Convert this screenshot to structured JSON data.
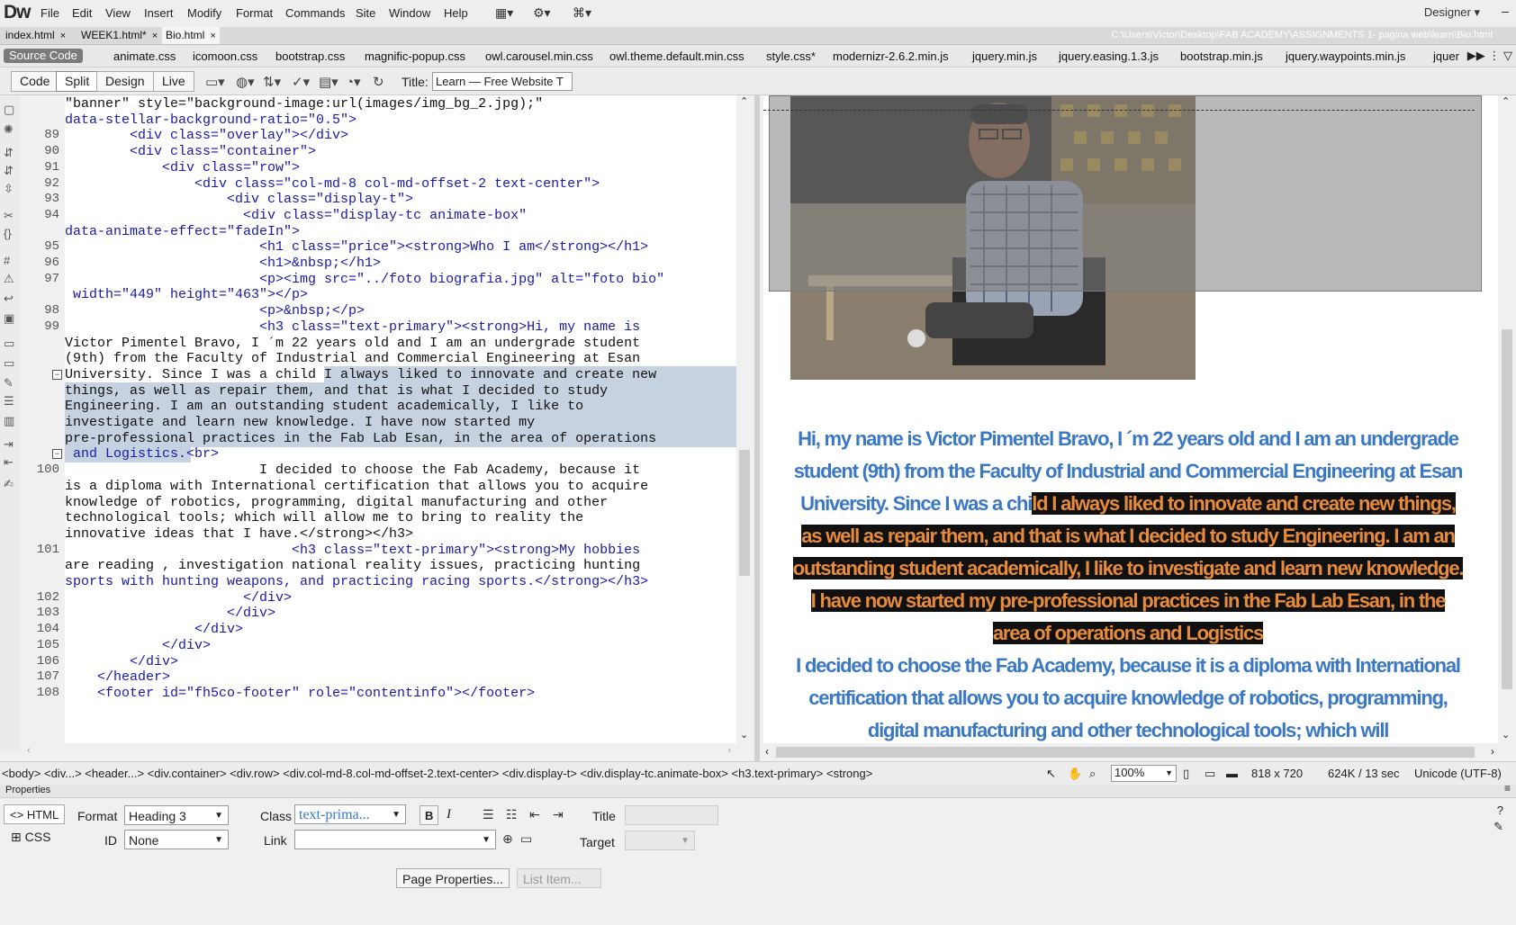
{
  "app": {
    "logo": "Dw",
    "layout_mode": "Designer"
  },
  "menu": [
    "File",
    "Edit",
    "View",
    "Insert",
    "Modify",
    "Format",
    "Commands",
    "Site",
    "Window",
    "Help"
  ],
  "doc_tabs": [
    {
      "label": "index.html",
      "active": false
    },
    {
      "label": "WEEK1.html*",
      "active": false
    },
    {
      "label": "Bio.html",
      "active": true
    }
  ],
  "doc_path": "C:\\Users\\Victor\\Desktop\\FAB ACADEMY\\ASSIGNMENTS 1- pagina web\\learn\\Bio.html",
  "related": {
    "source_code": "Source Code",
    "files": [
      "animate.css",
      "icomoon.css",
      "bootstrap.css",
      "magnific-popup.css",
      "owl.carousel.min.css",
      "owl.theme.default.min.css",
      "style.css*",
      "modernizr-2.6.2.min.js",
      "jquery.min.js",
      "jquery.easing.1.3.js",
      "bootstrap.min.js",
      "jquery.waypoints.min.js",
      "jquer"
    ]
  },
  "view_buttons": [
    "Code",
    "Split",
    "Design",
    "Live"
  ],
  "title_label": "Title:",
  "title_value": "Learn — Free Website T",
  "code_lines": [
    {
      "n": "",
      "t": "\"banner\" style=\"background-image:url(images/img_bg_2.jpg);\""
    },
    {
      "n": "",
      "t": "data-stellar-background-ratio=\"0.5\">"
    },
    {
      "n": "89",
      "t": "        <div class=\"overlay\"></div>"
    },
    {
      "n": "90",
      "t": "        <div class=\"container\">"
    },
    {
      "n": "91",
      "t": "            <div class=\"row\">"
    },
    {
      "n": "92",
      "t": "                <div class=\"col-md-8 col-md-offset-2 text-center\">"
    },
    {
      "n": "93",
      "t": "                    <div class=\"display-t\">"
    },
    {
      "n": "94",
      "t": "                      <div class=\"display-tc animate-box\""
    },
    {
      "n": "",
      "t": "data-animate-effect=\"fadeIn\">"
    },
    {
      "n": "95",
      "t": "                        <h1 class=\"price\"><strong>Who I am</strong></h1>"
    },
    {
      "n": "96",
      "t": "                        <h1>&nbsp;</h1>"
    },
    {
      "n": "97",
      "t": "                        <p><img src=\"../foto biografia.jpg\" alt=\"foto bio\""
    },
    {
      "n": "",
      "t": " width=\"449\" height=\"463\"></p>"
    },
    {
      "n": "98",
      "t": "                        <p>&nbsp;</p>"
    },
    {
      "n": "99",
      "t": "                        <h3 class=\"text-primary\"><strong>Hi, my name is"
    },
    {
      "n": "",
      "t": "Victor Pimentel Bravo, I ´m 22 years old and I am an undergrade student"
    },
    {
      "n": "",
      "t": "(9th) from the Faculty of Industrial and Commercial Engineering at Esan"
    },
    {
      "n": "",
      "t": "University. Since I was a child I always liked to innovate and create new"
    },
    {
      "n": "",
      "t": "things, as well as repair them, and that is what I decided to study"
    },
    {
      "n": "",
      "t": "Engineering. I am an outstanding student academically, I like to"
    },
    {
      "n": "",
      "t": "investigate and learn new knowledge. I have now started my"
    },
    {
      "n": "",
      "t": "pre-professional practices in the Fab Lab Esan, in the area of operations"
    },
    {
      "n": "",
      "t": " and Logistics.<br>"
    },
    {
      "n": "100",
      "t": "                        I decided to choose the Fab Academy, because it"
    },
    {
      "n": "",
      "t": "is a diploma with International certification that allows you to acquire"
    },
    {
      "n": "",
      "t": "knowledge of robotics, programming, digital manufacturing and other"
    },
    {
      "n": "",
      "t": "technological tools; which will allow me to bring to reality the"
    },
    {
      "n": "",
      "t": "innovative ideas that I have.</strong></h3>"
    },
    {
      "n": "101",
      "t": "                            <h3 class=\"text-primary\"><strong>My hobbies"
    },
    {
      "n": "",
      "t": "are reading , investigation national reality issues, practicing hunting"
    },
    {
      "n": "",
      "t": "sports with hunting weapons, and practicing racing sports.</strong></h3>"
    },
    {
      "n": "102",
      "t": "                      </div>"
    },
    {
      "n": "103",
      "t": "                    </div>"
    },
    {
      "n": "104",
      "t": "                </div>"
    },
    {
      "n": "105",
      "t": "            </div>"
    },
    {
      "n": "106",
      "t": "        </div>"
    },
    {
      "n": "107",
      "t": "    </header>"
    },
    {
      "n": "108",
      "t": "    <footer id=\"fh5co-footer\" role=\"contentinfo\"></footer>"
    }
  ],
  "design_text": {
    "plain1": "Hi, my name is Victor Pimentel Bravo, I ´m 22 years old and I am an undergrade student (9th) from the Faculty of Industrial and Commercial Engineering at Esan University. Since I was a chi",
    "selected": "ld I always liked to innovate and create new things, as well as repair them, and that is what I decided to study Engineering. I am an outstanding student academically, I like to investigate and learn new knowledge. I have now started my pre-professional practices in the Fab Lab Esan, in the area of operations and Logistics",
    "plain2": "I decided to choose the Fab Academy, because it is a diploma with International certification that allows you to acquire knowledge of robotics, programming, digital manufacturing and other technological tools; which will"
  },
  "status": {
    "tag_path": "<body> <div...> <header...> <div.container> <div.row> <div.col-md-8.col-md-offset-2.text-center> <div.display-t> <div.display-tc.animate-box> <h3.text-primary> <strong>",
    "zoom": "100%",
    "size": "818 x 720",
    "weight": "624K / 13 sec",
    "encoding": "Unicode (UTF-8)"
  },
  "properties": {
    "title": "Properties",
    "html_tab": "HTML",
    "css_tab": "CSS",
    "format_label": "Format",
    "format_value": "Heading 3",
    "class_label": "Class",
    "class_value": "text-prima...",
    "id_label": "ID",
    "id_value": "None",
    "link_label": "Link",
    "title_label": "Title",
    "target_label": "Target",
    "page_props": "Page Properties...",
    "list_item": "List Item..."
  }
}
